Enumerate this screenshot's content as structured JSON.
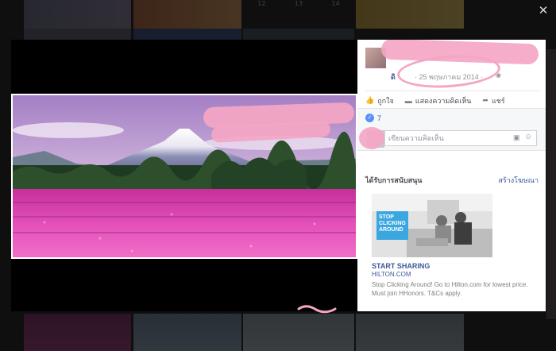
{
  "background": {
    "calendar_days": [
      "12",
      "13",
      "14"
    ]
  },
  "viewer": {
    "close_label": "✕"
  },
  "post": {
    "poster_name_fragment": "ดิ",
    "date": "· 25 พฤษภาคม 2014 ·",
    "privacy_icon": "globe-icon",
    "actions": {
      "like": "ถูกใจ",
      "comment": "แสดงความคิดเห็น",
      "share": "แชร์"
    },
    "like_count": "7",
    "comment_placeholder": "เขียนความคิดเห็น"
  },
  "sponsored": {
    "label": "ได้รับการสนับสนุน",
    "create_ad": "สร้างโฆษณา",
    "ad": {
      "image_text": "STOP CLICKING AROUND",
      "title": "START SHARING",
      "domain": "HILTON.COM",
      "description": "Stop Clicking Around! Go to Hilton.com for lowest price. Must join HHonors. T&Cs apply."
    }
  },
  "colors": {
    "link_blue": "#3b5998",
    "like_blue": "#5890ff",
    "ad_blue": "#3aa7e0",
    "redaction_pink": "#f4a6c4",
    "phlox_pink": "#e03fae"
  }
}
